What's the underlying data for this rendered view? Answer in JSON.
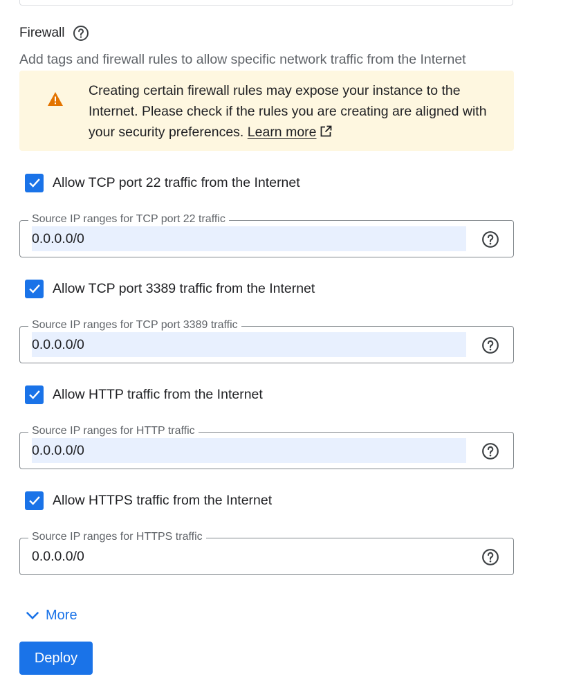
{
  "firewall": {
    "title": "Firewall",
    "description": "Add tags and firewall rules to allow specific network traffic from the Internet",
    "warning": {
      "text": "Creating certain firewall rules may expose your instance to the Internet. Please check if the rules you are creating are aligned with your security preferences.",
      "link_label": "Learn more"
    },
    "rules": [
      {
        "checkbox_label": "Allow TCP port 22 traffic from the Internet",
        "checked": true,
        "field_label": "Source IP ranges for TCP port 22 traffic",
        "value": "0.0.0.0/0"
      },
      {
        "checkbox_label": "Allow TCP port 3389 traffic from the Internet",
        "checked": true,
        "field_label": "Source IP ranges for TCP port 3389 traffic",
        "value": "0.0.0.0/0"
      },
      {
        "checkbox_label": "Allow HTTP traffic from the Internet",
        "checked": true,
        "field_label": "Source IP ranges for HTTP traffic",
        "value": "0.0.0.0/0"
      },
      {
        "checkbox_label": "Allow HTTPS traffic from the Internet",
        "checked": true,
        "field_label": "Source IP ranges for HTTPS traffic",
        "value": "0.0.0.0/0"
      }
    ]
  },
  "more_label": "More",
  "deploy_label": "Deploy",
  "icons": {
    "help": "help-circle-icon",
    "warning": "warning-triangle-icon",
    "external": "open-in-new-icon",
    "check": "check-icon",
    "chevron": "chevron-down-icon"
  },
  "colors": {
    "accent": "#1a73e8",
    "warning_bg": "#fef7e0",
    "warning_icon": "#e37400",
    "autofill_bg": "#e8f0fe"
  }
}
